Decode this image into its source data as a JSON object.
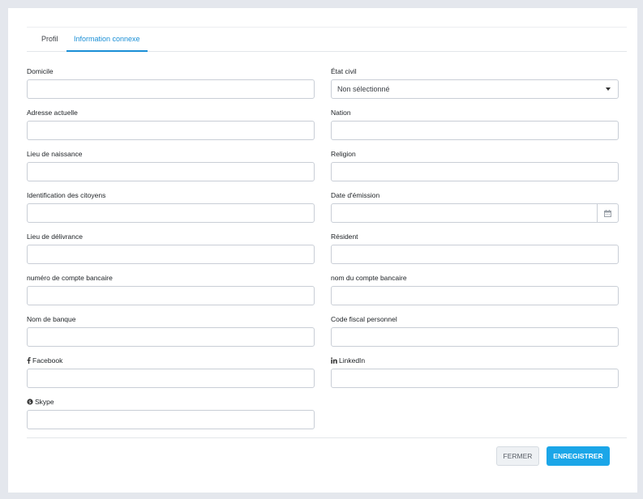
{
  "tabs": [
    {
      "label": "Profil"
    },
    {
      "label": "Information connexe"
    }
  ],
  "fields": {
    "domicile": {
      "label": "Domicile",
      "value": ""
    },
    "etat_civil": {
      "label": "État civil",
      "value": "Non sélectionné"
    },
    "adresse_actuelle": {
      "label": "Adresse actuelle",
      "value": ""
    },
    "nation": {
      "label": "Nation",
      "value": ""
    },
    "lieu_naissance": {
      "label": "Lieu de naissance",
      "value": ""
    },
    "religion": {
      "label": "Religion",
      "value": ""
    },
    "identification": {
      "label": "Identification des citoyens",
      "value": ""
    },
    "date_emission": {
      "label": "Date d'émission",
      "value": ""
    },
    "lieu_delivrance": {
      "label": "Lieu de délivrance",
      "value": ""
    },
    "resident": {
      "label": "Résident",
      "value": ""
    },
    "numero_compte": {
      "label": "numéro de compte bancaire",
      "value": ""
    },
    "nom_compte": {
      "label": "nom du compte bancaire",
      "value": ""
    },
    "nom_banque": {
      "label": "Nom de banque",
      "value": ""
    },
    "code_fiscal": {
      "label": "Code fiscal personnel",
      "value": ""
    },
    "facebook": {
      "label": "Facebook",
      "value": ""
    },
    "linkedin": {
      "label": "LinkedIn",
      "value": ""
    },
    "skype": {
      "label": "Skype",
      "value": ""
    }
  },
  "icons": {
    "facebook": "facebook-icon",
    "linkedin": "linkedin-icon",
    "skype": "skype-icon",
    "calendar": "calendar-icon",
    "caret": "chevron-down-icon"
  },
  "buttons": {
    "close": "FERMER",
    "save": "ENREGISTRER"
  },
  "colors": {
    "accent": "#1a8fd6",
    "primary_button": "#1ba6e8"
  }
}
